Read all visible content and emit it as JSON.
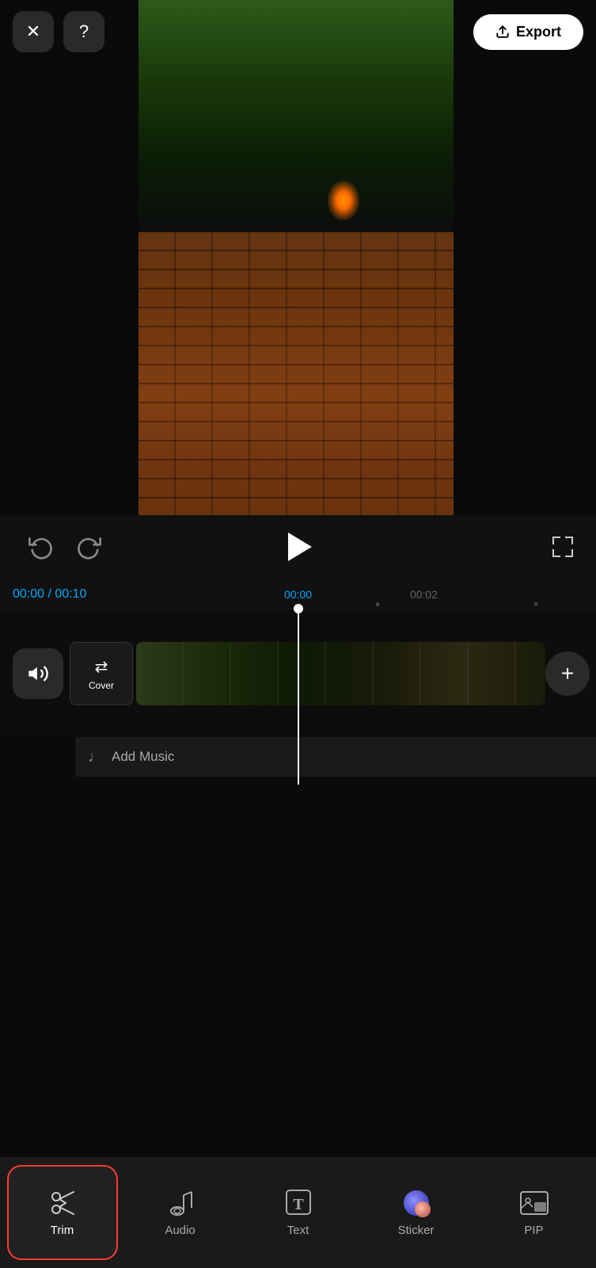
{
  "header": {
    "close_label": "✕",
    "help_label": "?",
    "export_label": "Export"
  },
  "playback": {
    "undo_label": "↩",
    "redo_label": "↪",
    "play_label": "▶",
    "time_current": "00:00",
    "time_total": "00:10",
    "timeline_start": "00:00",
    "timeline_mid": "00:02"
  },
  "track": {
    "cover_label": "Cover",
    "add_music_label": "Add Music"
  },
  "toolbar": {
    "items": [
      {
        "id": "trim",
        "label": "Trim",
        "active": true
      },
      {
        "id": "audio",
        "label": "Audio",
        "active": false
      },
      {
        "id": "text",
        "label": "Text",
        "active": false
      },
      {
        "id": "sticker",
        "label": "Sticker",
        "active": false
      },
      {
        "id": "pip",
        "label": "PIP",
        "active": false
      }
    ]
  },
  "colors": {
    "accent_blue": "#00aaff",
    "accent_red": "#ff3b30",
    "bg_dark": "#0a0a0a",
    "bg_medium": "#1a1a1a",
    "text_primary": "#ffffff",
    "text_secondary": "#aaaaaa"
  }
}
